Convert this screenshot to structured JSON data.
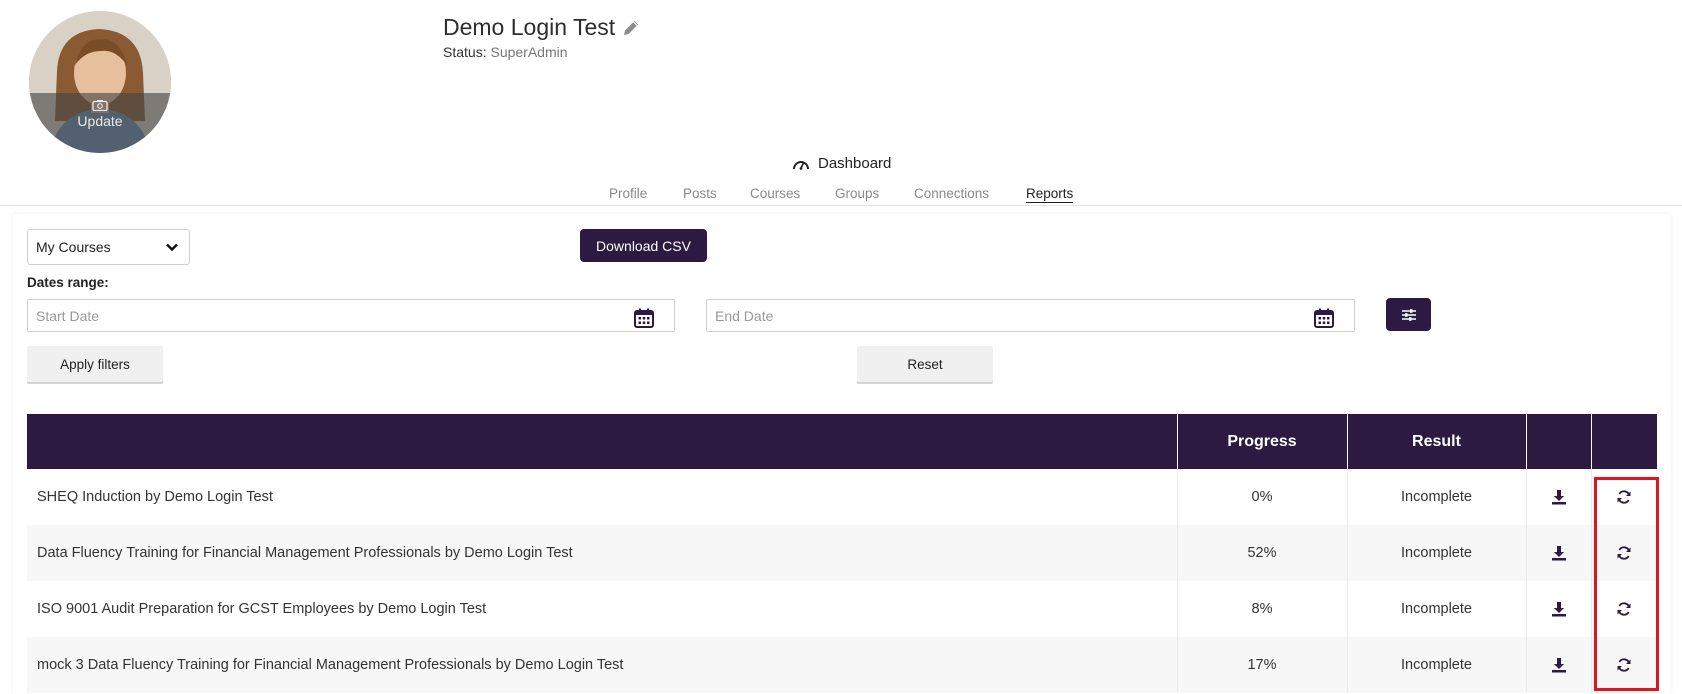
{
  "header": {
    "name": "Demo Login Test",
    "status_label": "Status:",
    "status_value": "SuperAdmin",
    "avatar_update_label": "Update"
  },
  "nav": {
    "dashboard_label": "Dashboard",
    "tabs": [
      {
        "label": "Profile",
        "active": false
      },
      {
        "label": "Posts",
        "active": false
      },
      {
        "label": "Courses",
        "active": false
      },
      {
        "label": "Groups",
        "active": false
      },
      {
        "label": "Connections",
        "active": false
      },
      {
        "label": "Reports",
        "active": true
      }
    ]
  },
  "filters": {
    "course_select_value": "My Courses",
    "download_csv_label": "Download CSV",
    "dates_range_label": "Dates range:",
    "start_date_placeholder": "Start Date",
    "end_date_placeholder": "End Date",
    "apply_label": "Apply filters",
    "reset_label": "Reset"
  },
  "table": {
    "headers": [
      "",
      "Progress",
      "Result",
      "",
      ""
    ],
    "rows": [
      {
        "course": "SHEQ Induction by Demo Login Test",
        "progress": "0%",
        "result": "Incomplete"
      },
      {
        "course": "Data Fluency Training for Financial Management Professionals by Demo Login Test",
        "progress": "52%",
        "result": "Incomplete"
      },
      {
        "course": "ISO 9001 Audit Preparation for GCST Employees by Demo Login Test",
        "progress": "8%",
        "result": "Incomplete"
      },
      {
        "course": "mock 3 Data Fluency Training for Financial Management Professionals by Demo Login Test",
        "progress": "17%",
        "result": "Incomplete"
      }
    ]
  },
  "icons": {
    "edit": "pencil-icon",
    "dashboard": "speedometer-icon",
    "avatar_camera": "camera-icon",
    "select_chevron": "chevron-down-icon",
    "calendar": "calendar-icon",
    "filter": "sliders-icon",
    "row_download": "download-icon",
    "row_refresh": "refresh-icon"
  },
  "colors": {
    "brand": "#2d1a42",
    "highlight": "#e0141e"
  }
}
